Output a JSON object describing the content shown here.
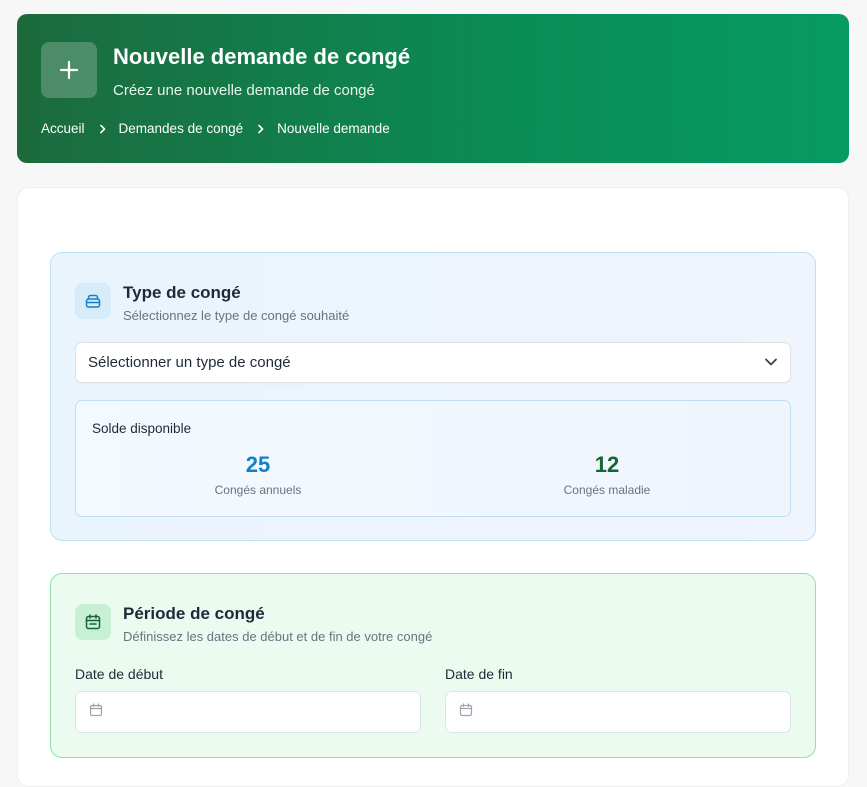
{
  "header": {
    "icon": "plus-icon",
    "title": "Nouvelle demande de congé",
    "subtitle": "Créez une nouvelle demande de congé",
    "breadcrumb": [
      "Accueil",
      "Demandes de congé",
      "Nouvelle demande"
    ]
  },
  "type_section": {
    "icon": "briefcase-icon",
    "title": "Type de congé",
    "description": "Sélectionnez le type de congé souhaité",
    "select_value": "Sélectionner un type de congé",
    "balance": {
      "title": "Solde disponible",
      "annual_value": "25",
      "annual_label": "Congés annuels",
      "sick_value": "12",
      "sick_label": "Congés maladie"
    }
  },
  "period_section": {
    "icon": "calendar-icon",
    "title": "Période de congé",
    "description": "Définissez les dates de début et de fin de votre congé",
    "start_label": "Date de début",
    "end_label": "Date de fin"
  },
  "colors": {
    "header_start": "#1c6a3c",
    "header_end": "#079a63",
    "annual_accent": "#1083c8",
    "sick_accent": "#166534"
  }
}
